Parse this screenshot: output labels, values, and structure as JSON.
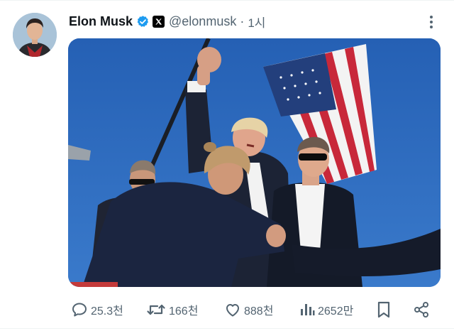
{
  "tweet": {
    "author": {
      "display_name": "Elon Musk",
      "handle": "@elonmusk",
      "verified": true,
      "badge_icon": "x-logo-icon",
      "avatar_icon": "profile-photo"
    },
    "separator": "·",
    "timestamp": "1시",
    "more_icon": "more-vertical-icon",
    "media": {
      "description_icon": "photo",
      "sky_color": "#2b66b8"
    },
    "actions": {
      "reply": {
        "icon": "reply-icon",
        "count": "25.3천"
      },
      "repost": {
        "icon": "repost-icon",
        "count": "166천"
      },
      "like": {
        "icon": "heart-icon",
        "count": "888천"
      },
      "views": {
        "icon": "views-chart-icon",
        "count": "2652만"
      },
      "bookmark": {
        "icon": "bookmark-icon"
      },
      "share": {
        "icon": "share-icon"
      }
    }
  },
  "colors": {
    "verified_blue": "#1d9bf0",
    "secondary_text": "#536471",
    "primary_text": "#0f1419"
  }
}
